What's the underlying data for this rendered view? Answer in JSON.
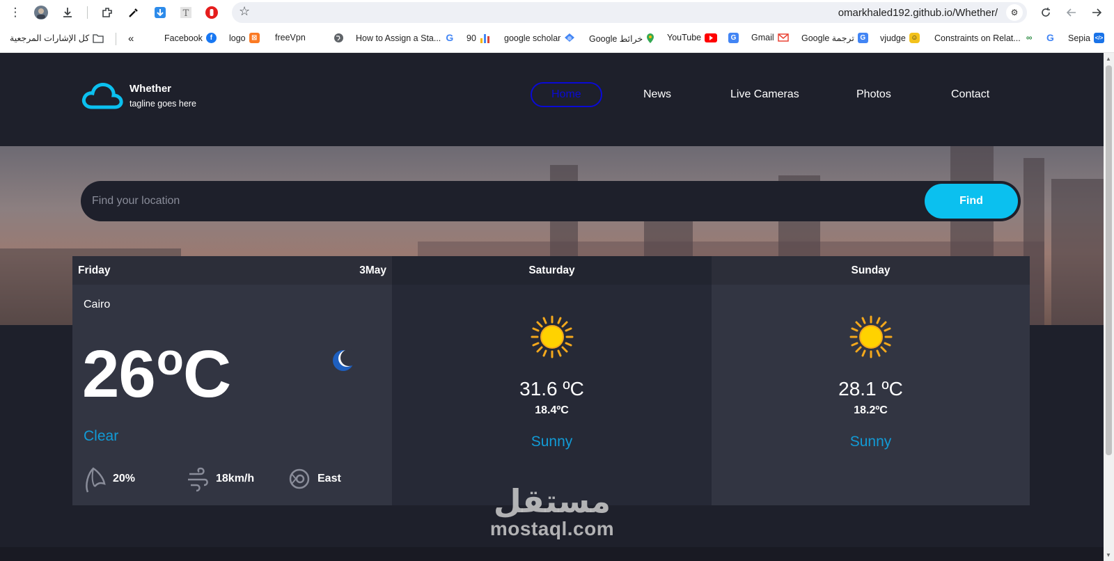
{
  "browser": {
    "url": "omarkhaled192.github.io/Whether/",
    "bookmarks": [
      {
        "label": "كل الإشارات المرجعية",
        "icon": "folder-icon"
      },
      {
        "label": "Facebook",
        "icon": "facebook-icon"
      },
      {
        "label": "logo",
        "icon": "xampp-icon"
      },
      {
        "label": "freeVpn",
        "icon": "globe-icon"
      },
      {
        "label": "How to Assign a Sta...",
        "icon": "google-icon"
      },
      {
        "label": "90",
        "icon": "bar-chart-icon"
      },
      {
        "label": "google scholar",
        "icon": "scholar-icon"
      },
      {
        "label": "Google خرائط",
        "icon": "maps-icon"
      },
      {
        "label": "YouTube",
        "icon": "youtube-icon"
      },
      {
        "label": "Gmail",
        "icon": "translate-icon"
      },
      {
        "label": "Google ترجمة",
        "icon": "gmail-icon"
      },
      {
        "label": "vjudge",
        "icon": "translate-icon"
      },
      {
        "label": "Constraints on Relat...",
        "icon": "vjudge-icon"
      },
      {
        "label": "Sepia",
        "icon": "google-icon"
      }
    ]
  },
  "site": {
    "brand": "Whether",
    "tagline": "tagline goes here",
    "nav": [
      "Home",
      "News",
      "Live Cameras",
      "Photos",
      "Contact"
    ],
    "active_nav": "Home"
  },
  "search": {
    "placeholder": "Find your location",
    "button": "Find"
  },
  "forecast": {
    "today": {
      "day": "Friday",
      "date": "3May",
      "city": "Cairo",
      "temp": "26",
      "unit": "o",
      "unit_c": "C",
      "condition": "Clear",
      "humidity": "20%",
      "wind_speed": "18km/h",
      "wind_dir": "East",
      "icon": "moon-icon"
    },
    "days": [
      {
        "day": "Saturday",
        "max": "31.6 ºC",
        "min": "18.4ºC",
        "condition": "Sunny",
        "icon": "sun-icon"
      },
      {
        "day": "Sunday",
        "max": "28.1 ºC",
        "min": "18.2ºC",
        "condition": "Sunny",
        "icon": "sun-icon"
      }
    ]
  },
  "watermark": {
    "arabic": "مستقل",
    "latin": "mostaql.com"
  },
  "colors": {
    "accent": "#0bc0ef",
    "condition_text": "#129bd6",
    "active_nav": "#0a0ad6",
    "page_bg": "#1e202b"
  }
}
